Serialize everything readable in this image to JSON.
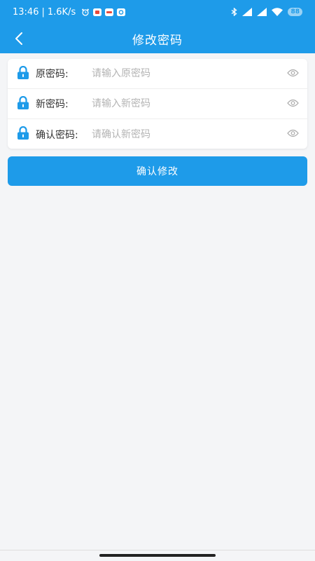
{
  "status_bar": {
    "time": "13:46",
    "separator": "|",
    "net_speed": "1.6K/s",
    "battery": "88",
    "icons": [
      "alarm-icon",
      "app-notification-icon",
      "message-icon",
      "app-icon",
      "bluetooth-icon",
      "signal-icon",
      "signal-icon",
      "wifi-icon",
      "battery-icon"
    ]
  },
  "header": {
    "title": "修改密码",
    "back_icon": "chevron-left-icon"
  },
  "form": {
    "fields": [
      {
        "label": "原密码:",
        "placeholder": "请输入原密码",
        "value": ""
      },
      {
        "label": "新密码:",
        "placeholder": "请输入新密码",
        "value": ""
      },
      {
        "label": "确认密码:",
        "placeholder": "请确认新密码",
        "value": ""
      }
    ],
    "icons": {
      "field": "lock-icon",
      "toggle": "eye-icon"
    }
  },
  "submit": {
    "label": "确认修改"
  },
  "colors": {
    "primary": "#1e9be9",
    "background": "#f4f5f7",
    "label": "#333333",
    "placeholder": "#b4b4b4"
  }
}
